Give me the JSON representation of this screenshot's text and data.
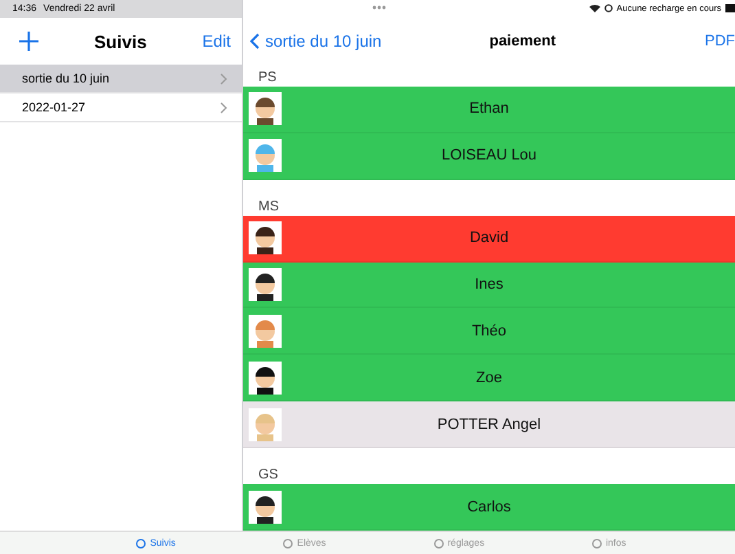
{
  "status_bar": {
    "time": "14:36",
    "date": "Vendredi 22 avril",
    "battery_text": "Aucune recharge en cours"
  },
  "sidebar": {
    "title": "Suivis",
    "edit_label": "Edit",
    "items": [
      {
        "label": "sortie du 10 juin",
        "selected": true
      },
      {
        "label": "2022-01-27",
        "selected": false
      }
    ]
  },
  "detail": {
    "back_label": "sortie du 10 juin",
    "title": "paiement",
    "action_label": "PDF",
    "sections": [
      {
        "title": "PS",
        "students": [
          {
            "name": "Ethan",
            "color": "#34c759"
          },
          {
            "name": "LOISEAU Lou",
            "color": "#34c759"
          }
        ]
      },
      {
        "title": "MS",
        "students": [
          {
            "name": "David",
            "color": "#ff3b30"
          },
          {
            "name": "Ines",
            "color": "#34c759"
          },
          {
            "name": "Théo",
            "color": "#34c759"
          },
          {
            "name": "Zoe",
            "color": "#34c759"
          },
          {
            "name": "POTTER Angel",
            "color": "#e9e4e8"
          }
        ]
      },
      {
        "title": "GS",
        "students": [
          {
            "name": "Carlos",
            "color": "#34c759"
          }
        ]
      }
    ]
  },
  "tab_bar": [
    {
      "label": "Suivis",
      "selected": true
    },
    {
      "label": "Elèves",
      "selected": false
    },
    {
      "label": "réglages",
      "selected": false
    },
    {
      "label": "infos",
      "selected": false
    }
  ]
}
